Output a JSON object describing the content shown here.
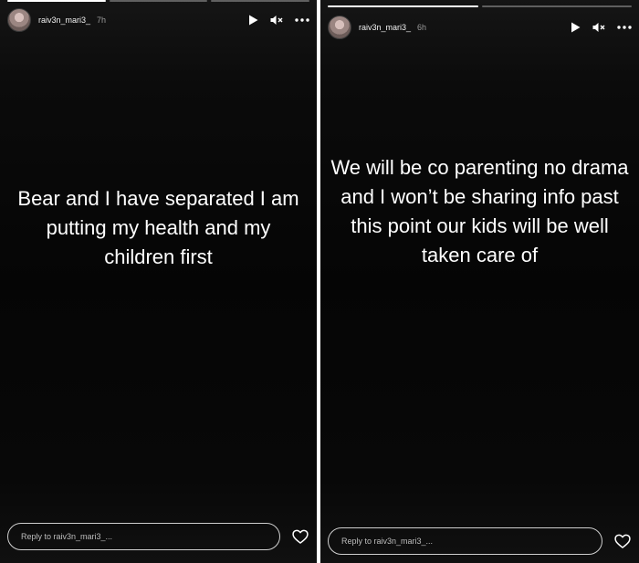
{
  "left_story": {
    "progress": [
      1,
      0,
      0
    ],
    "username": "raiv3n_mari3_",
    "time": "7h",
    "text": "Bear and I have separated I am putting my health and my children first",
    "reply_placeholder": "Reply to raiv3n_mari3_...",
    "icons": [
      "play-icon",
      "mute-icon",
      "more-icon",
      "heart-icon"
    ]
  },
  "right_story": {
    "progress": [
      1,
      0
    ],
    "username": "raiv3n_mari3_",
    "time": "6h",
    "text": "We will be co parenting no drama and I won’t be sharing info past this point our kids will be well taken care of",
    "reply_placeholder": "Reply to raiv3n_mari3_...",
    "icons": [
      "play-icon",
      "mute-icon",
      "more-icon",
      "heart-icon"
    ]
  }
}
